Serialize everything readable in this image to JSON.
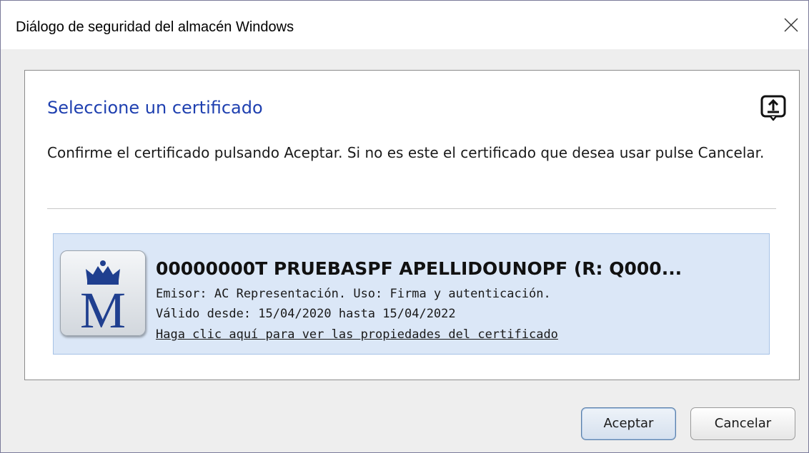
{
  "window": {
    "title": "Diálogo de seguridad del almacén Windows",
    "close_icon": "close-x-icon"
  },
  "dialog": {
    "heading": "Seleccione un certificado",
    "heading_color": "#1f40b0",
    "export_icon": "export-upload-icon",
    "message": "Confirme el certificado pulsando Aceptar. Si no es este el certificado que desea usar pulse Cancelar."
  },
  "certificate": {
    "issuer_logo": "fnmt-crown-m-logo",
    "logo_letter": "M",
    "name": "00000000T PRUEBASPF APELLIDOUNOPF (R: Q000...",
    "issuer": "Emisor: AC Representación. Uso: Firma y autenticación.",
    "validity": "Válido desde: 15/04/2020 hasta 15/04/2022",
    "properties_link": "Haga clic aquí para ver las propiedades del certificado",
    "selected_bg": "#dbe7f7"
  },
  "buttons": {
    "accept": "Aceptar",
    "cancel": "Cancelar"
  }
}
